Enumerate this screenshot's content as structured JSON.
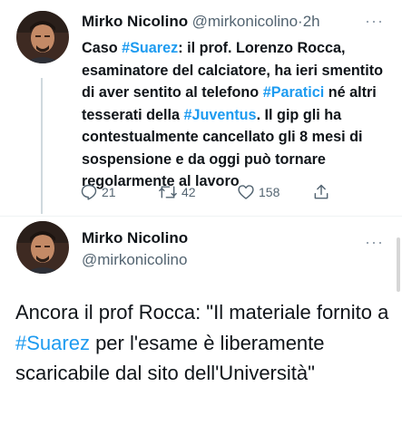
{
  "tweet": {
    "author_name": "Mirko Nicolino",
    "author_handle": "@mirkonicolino",
    "separator": "·",
    "time": "2h",
    "text_parts": [
      {
        "t": "Caso ",
        "link": false
      },
      {
        "t": "#Suarez",
        "link": true
      },
      {
        "t": ": il prof. Lorenzo Rocca, esaminatore del calciatore, ha ieri smentito di aver sentito al telefono ",
        "link": false
      },
      {
        "t": "#Paratici",
        "link": true
      },
      {
        "t": " né altri tesserati della ",
        "link": false
      },
      {
        "t": "#Juventus",
        "link": true
      },
      {
        "t": ". Il gip gli ha contestualmente cancellato gli 8 mesi di sospensione e da oggi può tornare regolarmente al lavoro",
        "link": false
      }
    ],
    "replies": "21",
    "retweets": "42",
    "likes": "158"
  },
  "reply": {
    "author_name": "Mirko Nicolino",
    "author_handle": "@mirkonicolino",
    "text_parts": [
      {
        "t": "Ancora il prof Rocca: \"Il materiale fornito a ",
        "link": false
      },
      {
        "t": "#Suarez",
        "link": true
      },
      {
        "t": " per l'esame è liberamente scaricabile dal sito dell'Università\"",
        "link": false
      }
    ]
  },
  "colors": {
    "link": "#1d9bf0",
    "muted": "#536471",
    "text": "#0f1419"
  },
  "icons": [
    "reply-icon",
    "retweet-icon",
    "like-icon",
    "share-icon",
    "more-icon"
  ]
}
